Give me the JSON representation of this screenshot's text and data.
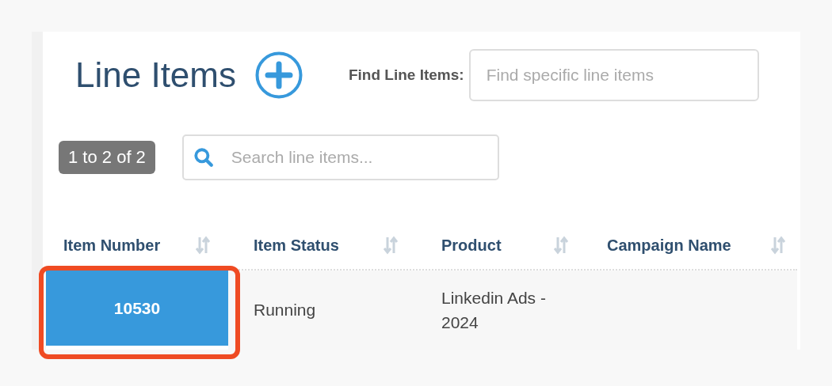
{
  "header": {
    "title": "Line Items",
    "find_label": "Find Line Items:",
    "find_placeholder": "Find specific line items"
  },
  "toolbar": {
    "count_badge": "1 to 2 of 2",
    "search": {
      "placeholder": "Search line items..."
    }
  },
  "table": {
    "columns": [
      "Item Number",
      "Item Status",
      "Product",
      "Campaign Name"
    ],
    "rows": [
      {
        "item_number": "10530",
        "status": "Running",
        "product": "Linkedin Ads - 2024",
        "selected": true,
        "outlined": true
      }
    ]
  }
}
